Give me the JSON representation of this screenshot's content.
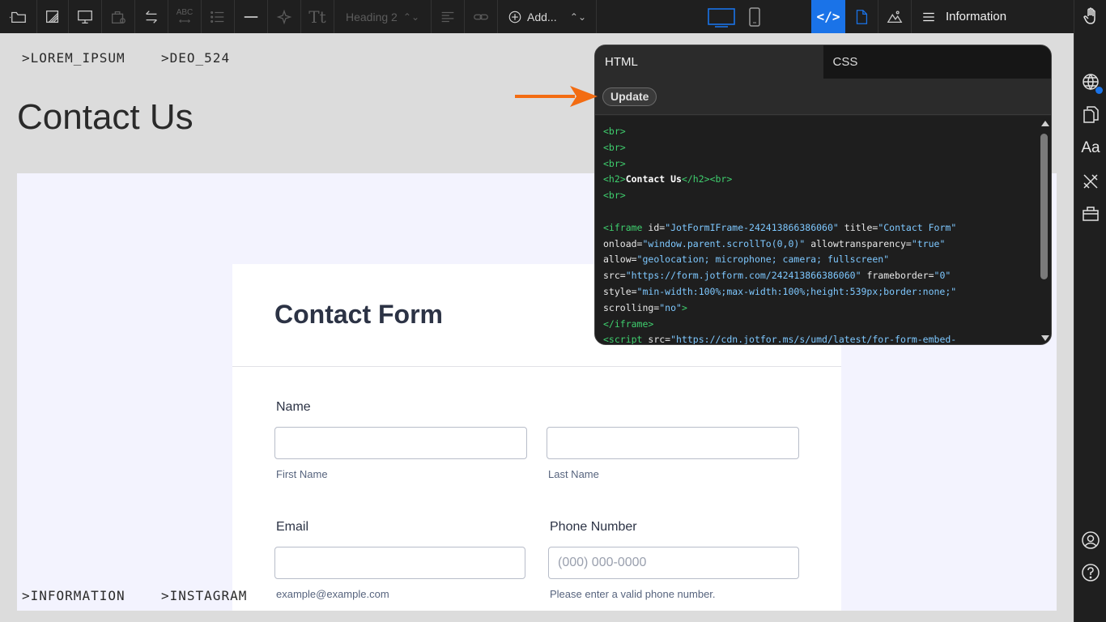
{
  "toolbar": {
    "heading_select": "Heading 2",
    "abc_label": "ABC",
    "add_label": "Add...",
    "code_label": "</>",
    "information_label": "Information"
  },
  "breadcrumbs": {
    "top": [
      "LOREM_IPSUM",
      "DEO_524"
    ],
    "bottom": [
      "INFORMATION",
      "INSTAGRAM"
    ]
  },
  "page": {
    "title": "Contact Us"
  },
  "form": {
    "title": "Contact Form",
    "name_label": "Name",
    "first_name_sub": "First Name",
    "last_name_sub": "Last Name",
    "email_label": "Email",
    "email_sub": "example@example.com",
    "phone_label": "Phone Number",
    "phone_placeholder": "(000) 000-0000",
    "phone_sub": "Please enter a valid phone number."
  },
  "code_panel": {
    "tabs": [
      "HTML",
      "CSS"
    ],
    "active_tab": "HTML",
    "update_label": "Update"
  },
  "sidebar": {
    "font_label": "Aa"
  },
  "colors": {
    "toolbar_bg": "#1f1f1f",
    "accent_blue": "#1a73e8",
    "arrow_orange": "#f36c12",
    "code_tag_green": "#3fcf6e",
    "code_string_blue": "#7ec8ff"
  }
}
